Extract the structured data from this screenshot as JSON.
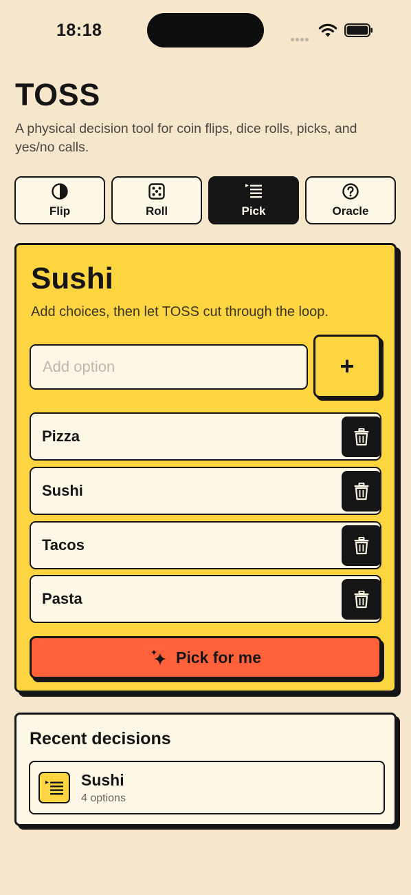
{
  "status_bar": {
    "time": "18:18"
  },
  "app": {
    "title": "TOSS",
    "subtitle": "A physical decision tool for coin flips, dice rolls, picks, and yes/no calls."
  },
  "modes": [
    {
      "label": "Flip",
      "icon": "contrast-circle-icon",
      "active": false
    },
    {
      "label": "Roll",
      "icon": "dice-icon",
      "active": false
    },
    {
      "label": "Pick",
      "icon": "list-icon",
      "active": true
    },
    {
      "label": "Oracle",
      "icon": "question-circle-icon",
      "active": false
    }
  ],
  "pick": {
    "result": "Sushi",
    "hint": "Add choices, then let TOSS cut through the loop.",
    "input_placeholder": "Add option",
    "input_value": "",
    "add_label": "+",
    "options": [
      "Pizza",
      "Sushi",
      "Tacos",
      "Pasta"
    ],
    "pick_button_label": "Pick for me"
  },
  "recent": {
    "title": "Recent decisions",
    "items": [
      {
        "title": "Sushi",
        "meta": "4 options",
        "icon": "list-icon"
      }
    ]
  },
  "colors": {
    "background": "#f5e6cc",
    "card_yellow": "#fdd541",
    "cream": "#fdf7e6",
    "ink": "#151515",
    "accent_orange": "#ff623b"
  }
}
